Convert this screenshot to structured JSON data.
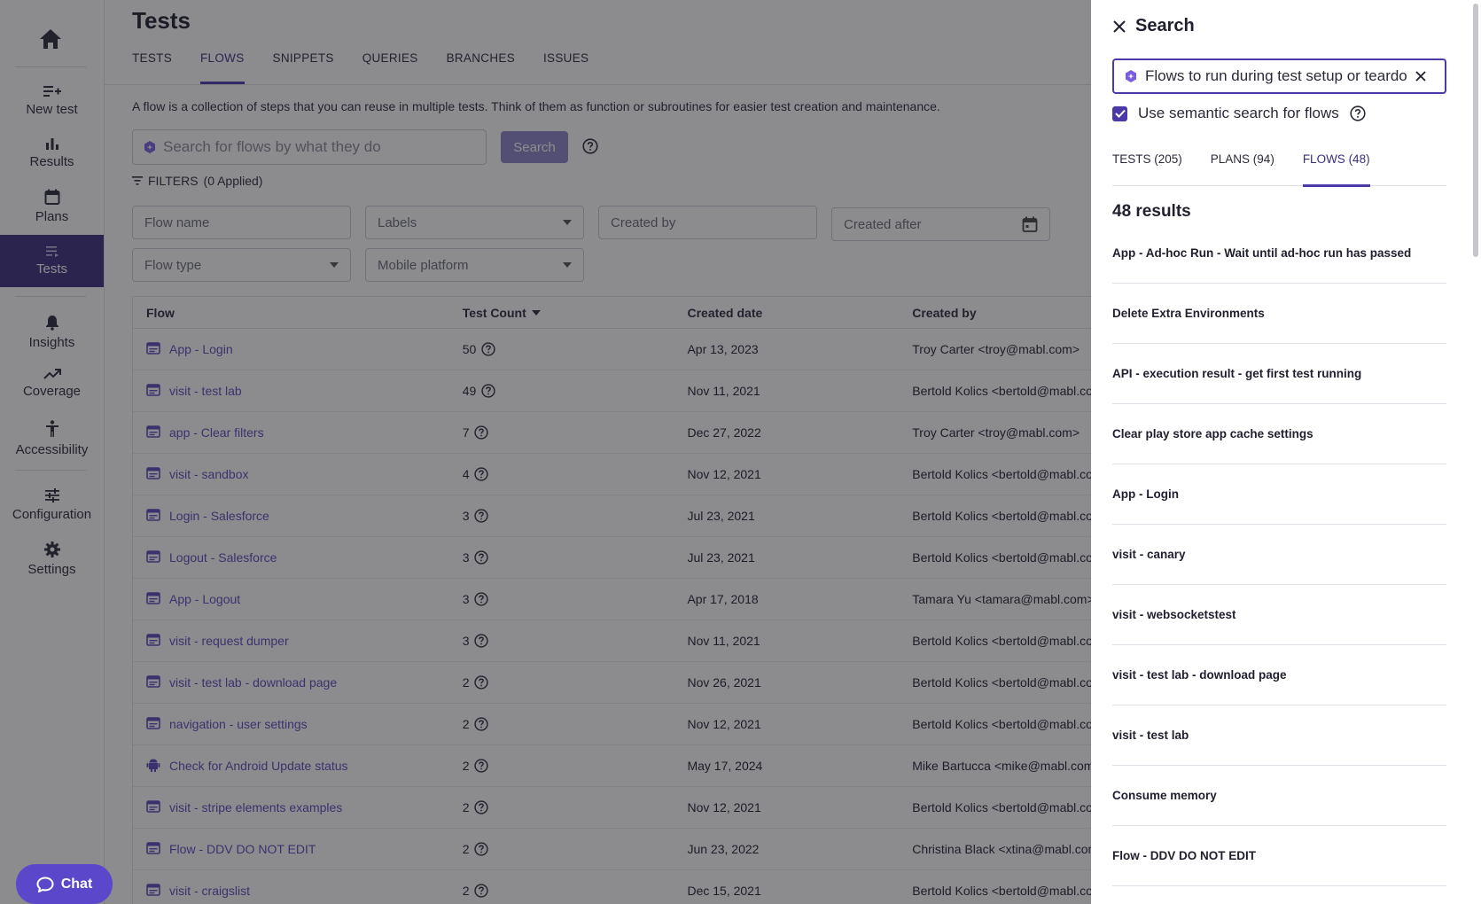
{
  "sidebar": {
    "home_icon": "home-icon",
    "items": [
      {
        "label": "New test",
        "icon": "playlist-add-icon"
      },
      {
        "label": "Results",
        "icon": "bar-chart-icon"
      },
      {
        "label": "Plans",
        "icon": "calendar-icon"
      },
      {
        "label": "Tests",
        "icon": "list-icon"
      },
      {
        "label": "Insights",
        "icon": "bell-icon"
      },
      {
        "label": "Coverage",
        "icon": "trending-up-icon"
      },
      {
        "label": "Accessibility",
        "icon": "accessibility-icon"
      },
      {
        "label": "Configuration",
        "icon": "sliders-icon"
      },
      {
        "label": "Settings",
        "icon": "gear-icon"
      }
    ],
    "active_item": "Tests"
  },
  "main": {
    "title": "Tests",
    "tabs": [
      "TESTS",
      "FLOWS",
      "SNIPPETS",
      "QUERIES",
      "BRANCHES",
      "ISSUES"
    ],
    "active_tab": "FLOWS",
    "description": "A flow is a collection of steps that you can reuse in multiple tests. Think of them as function or subroutines for easier test creation and maintenance.",
    "search": {
      "placeholder": "Search for flows by what they do",
      "button_label": "Search"
    },
    "filters_label": "FILTERS",
    "filters_applied": "(0 Applied)",
    "filter_fields": {
      "flow_name": "Flow name",
      "labels": "Labels",
      "created_by": "Created by",
      "created_after": "Created after",
      "flow_type": "Flow type",
      "mobile_platform": "Mobile platform"
    },
    "table": {
      "headers": {
        "flow": "Flow",
        "test_count": "Test Count",
        "created_date": "Created date",
        "created_by": "Created by"
      },
      "rows": [
        {
          "name": "App - Login",
          "count": "50",
          "date": "Apr 13, 2023",
          "creator": "Troy Carter <troy@mabl.com>",
          "icon": "flow-icon"
        },
        {
          "name": "visit - test lab",
          "count": "49",
          "date": "Nov 11, 2021",
          "creator": "Bertold Kolics <bertold@mabl.com>",
          "icon": "flow-icon"
        },
        {
          "name": "app - Clear filters",
          "count": "7",
          "date": "Dec 27, 2022",
          "creator": "Troy Carter <troy@mabl.com>",
          "icon": "flow-icon"
        },
        {
          "name": "visit - sandbox",
          "count": "4",
          "date": "Nov 12, 2021",
          "creator": "Bertold Kolics <bertold@mabl.com>",
          "icon": "flow-icon"
        },
        {
          "name": "Login - Salesforce",
          "count": "3",
          "date": "Jul 23, 2021",
          "creator": "Bertold Kolics <bertold@mabl.com>",
          "icon": "flow-icon"
        },
        {
          "name": "Logout - Salesforce",
          "count": "3",
          "date": "Jul 23, 2021",
          "creator": "Bertold Kolics <bertold@mabl.com>",
          "icon": "flow-icon"
        },
        {
          "name": "App - Logout",
          "count": "3",
          "date": "Apr 17, 2018",
          "creator": "Tamara Yu <tamara@mabl.com>",
          "icon": "flow-icon"
        },
        {
          "name": "visit - request dumper",
          "count": "3",
          "date": "Nov 11, 2021",
          "creator": "Bertold Kolics <bertold@mabl.com>",
          "icon": "flow-icon"
        },
        {
          "name": "visit - test lab - download page",
          "count": "2",
          "date": "Nov 26, 2021",
          "creator": "Bertold Kolics <bertold@mabl.com>",
          "icon": "flow-icon"
        },
        {
          "name": "navigation - user settings",
          "count": "2",
          "date": "Nov 12, 2021",
          "creator": "Bertold Kolics <bertold@mabl.com>",
          "icon": "flow-icon"
        },
        {
          "name": "Check for Android Update status",
          "count": "2",
          "date": "May 17, 2024",
          "creator": "Mike Bartucca <mike@mabl.com>",
          "icon": "android-icon"
        },
        {
          "name": "visit - stripe elements examples",
          "count": "2",
          "date": "Nov 12, 2021",
          "creator": "Bertold Kolics <bertold@mabl.com>",
          "icon": "flow-icon"
        },
        {
          "name": "Flow - DDV DO NOT EDIT",
          "count": "2",
          "date": "Jun 23, 2022",
          "creator": "Christina Black <xtina@mabl.com>",
          "icon": "flow-icon"
        },
        {
          "name": "visit - craigslist",
          "count": "2",
          "date": "Dec 15, 2021",
          "creator": "Bertold Kolics <bertold@mabl.com>",
          "icon": "flow-icon"
        }
      ]
    }
  },
  "chat": {
    "label": "Chat"
  },
  "search_panel": {
    "title": "Search",
    "query": "Flows to run during test setup or teardown",
    "semantic_label": "Use semantic search for flows",
    "semantic_checked": true,
    "tabs": [
      "TESTS (205)",
      "PLANS (94)",
      "FLOWS (48)"
    ],
    "active_tab": "FLOWS (48)",
    "result_count": "48 results",
    "results": [
      "App - Ad-hoc Run - Wait until ad-hoc run has passed",
      "Delete Extra Environments",
      "API - execution result - get first test running",
      "Clear play store app cache settings",
      "App - Login",
      "visit - canary",
      "visit - websocketstest",
      "visit - test lab - download page",
      "visit - test lab",
      "Consume memory",
      "Flow - DDV DO NOT EDIT"
    ]
  },
  "colors": {
    "accent": "#4a3aa8",
    "sidebar_active": "#3b2f7d",
    "link": "#5a4bb8",
    "chat": "#5a47c9"
  }
}
